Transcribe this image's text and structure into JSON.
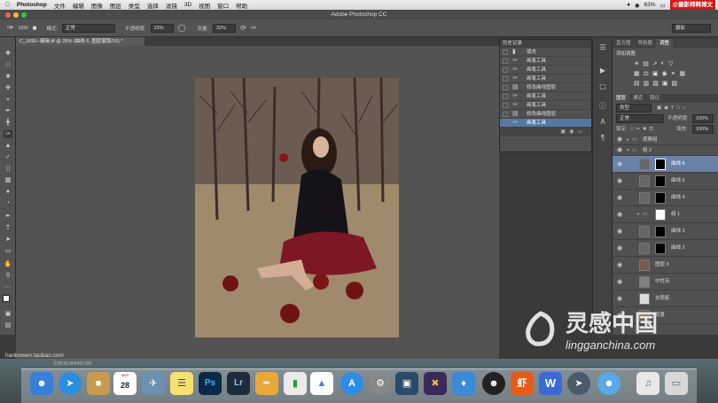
{
  "menubar": {
    "app_name": "Photoshop",
    "items": [
      "文件",
      "编辑",
      "图像",
      "图层",
      "类型",
      "选择",
      "滤镜",
      "3D",
      "视图",
      "窗口",
      "帮助"
    ],
    "battery": "63%",
    "brand_watermark": "@摄影师韩博文"
  },
  "window": {
    "title": "Adobe Photoshop CC",
    "workspace": "摄影"
  },
  "options_bar": {
    "brush_size": "1590",
    "mode_label": "模式:",
    "mode_value": "正常",
    "opacity_label": "不透明度:",
    "opacity_value": "23%",
    "flow_label": "流量:",
    "flow_value": "32%"
  },
  "document": {
    "tab_title": "C_1690--编辑.tif @ 25% (曲线 6, 图层蒙版/16) *"
  },
  "history": {
    "title": "历史记录",
    "items": [
      "填充",
      "画笔工具",
      "画笔工具",
      "画笔工具",
      "修改曲线图层",
      "画笔工具",
      "画笔工具",
      "修改曲线图层",
      "画笔工具"
    ],
    "selected_index": 8
  },
  "panels": {
    "tabs_top": [
      "直方图",
      "导航器",
      "调整"
    ],
    "adjust_title": "添加调整",
    "tabs_layers": [
      "图层",
      "通道",
      "路径"
    ],
    "kind_filter": "类型",
    "blend_mode": "正常",
    "opacity_label": "不透明度:",
    "opacity_value": "100%",
    "lock_label": "锁定:",
    "fill_label": "填充:",
    "fill_value": "100%"
  },
  "layers": [
    {
      "name": "观察组"
    },
    {
      "name": "组 2"
    },
    {
      "name": "曲线 6",
      "selected": true
    },
    {
      "name": "曲线 5"
    },
    {
      "name": "曲线 4"
    },
    {
      "name": "组 1"
    },
    {
      "name": "曲线 3"
    },
    {
      "name": "曲线 2"
    },
    {
      "name": "图层 3"
    },
    {
      "name": "中性灰"
    },
    {
      "name": "去瑕疵"
    },
    {
      "name": "背景"
    }
  ],
  "footer": {
    "shop_url": "hanbowen.taobao.com",
    "doc_info": "文档:96.6M/462.6M"
  },
  "dock": {
    "calendar_day": "28",
    "calendar_month": "OCT"
  },
  "watermark": {
    "cn": "灵感中国",
    "url": "lingganchina.com"
  },
  "colors": {
    "accent": "#5677a4",
    "dock_red": "#d01818"
  }
}
